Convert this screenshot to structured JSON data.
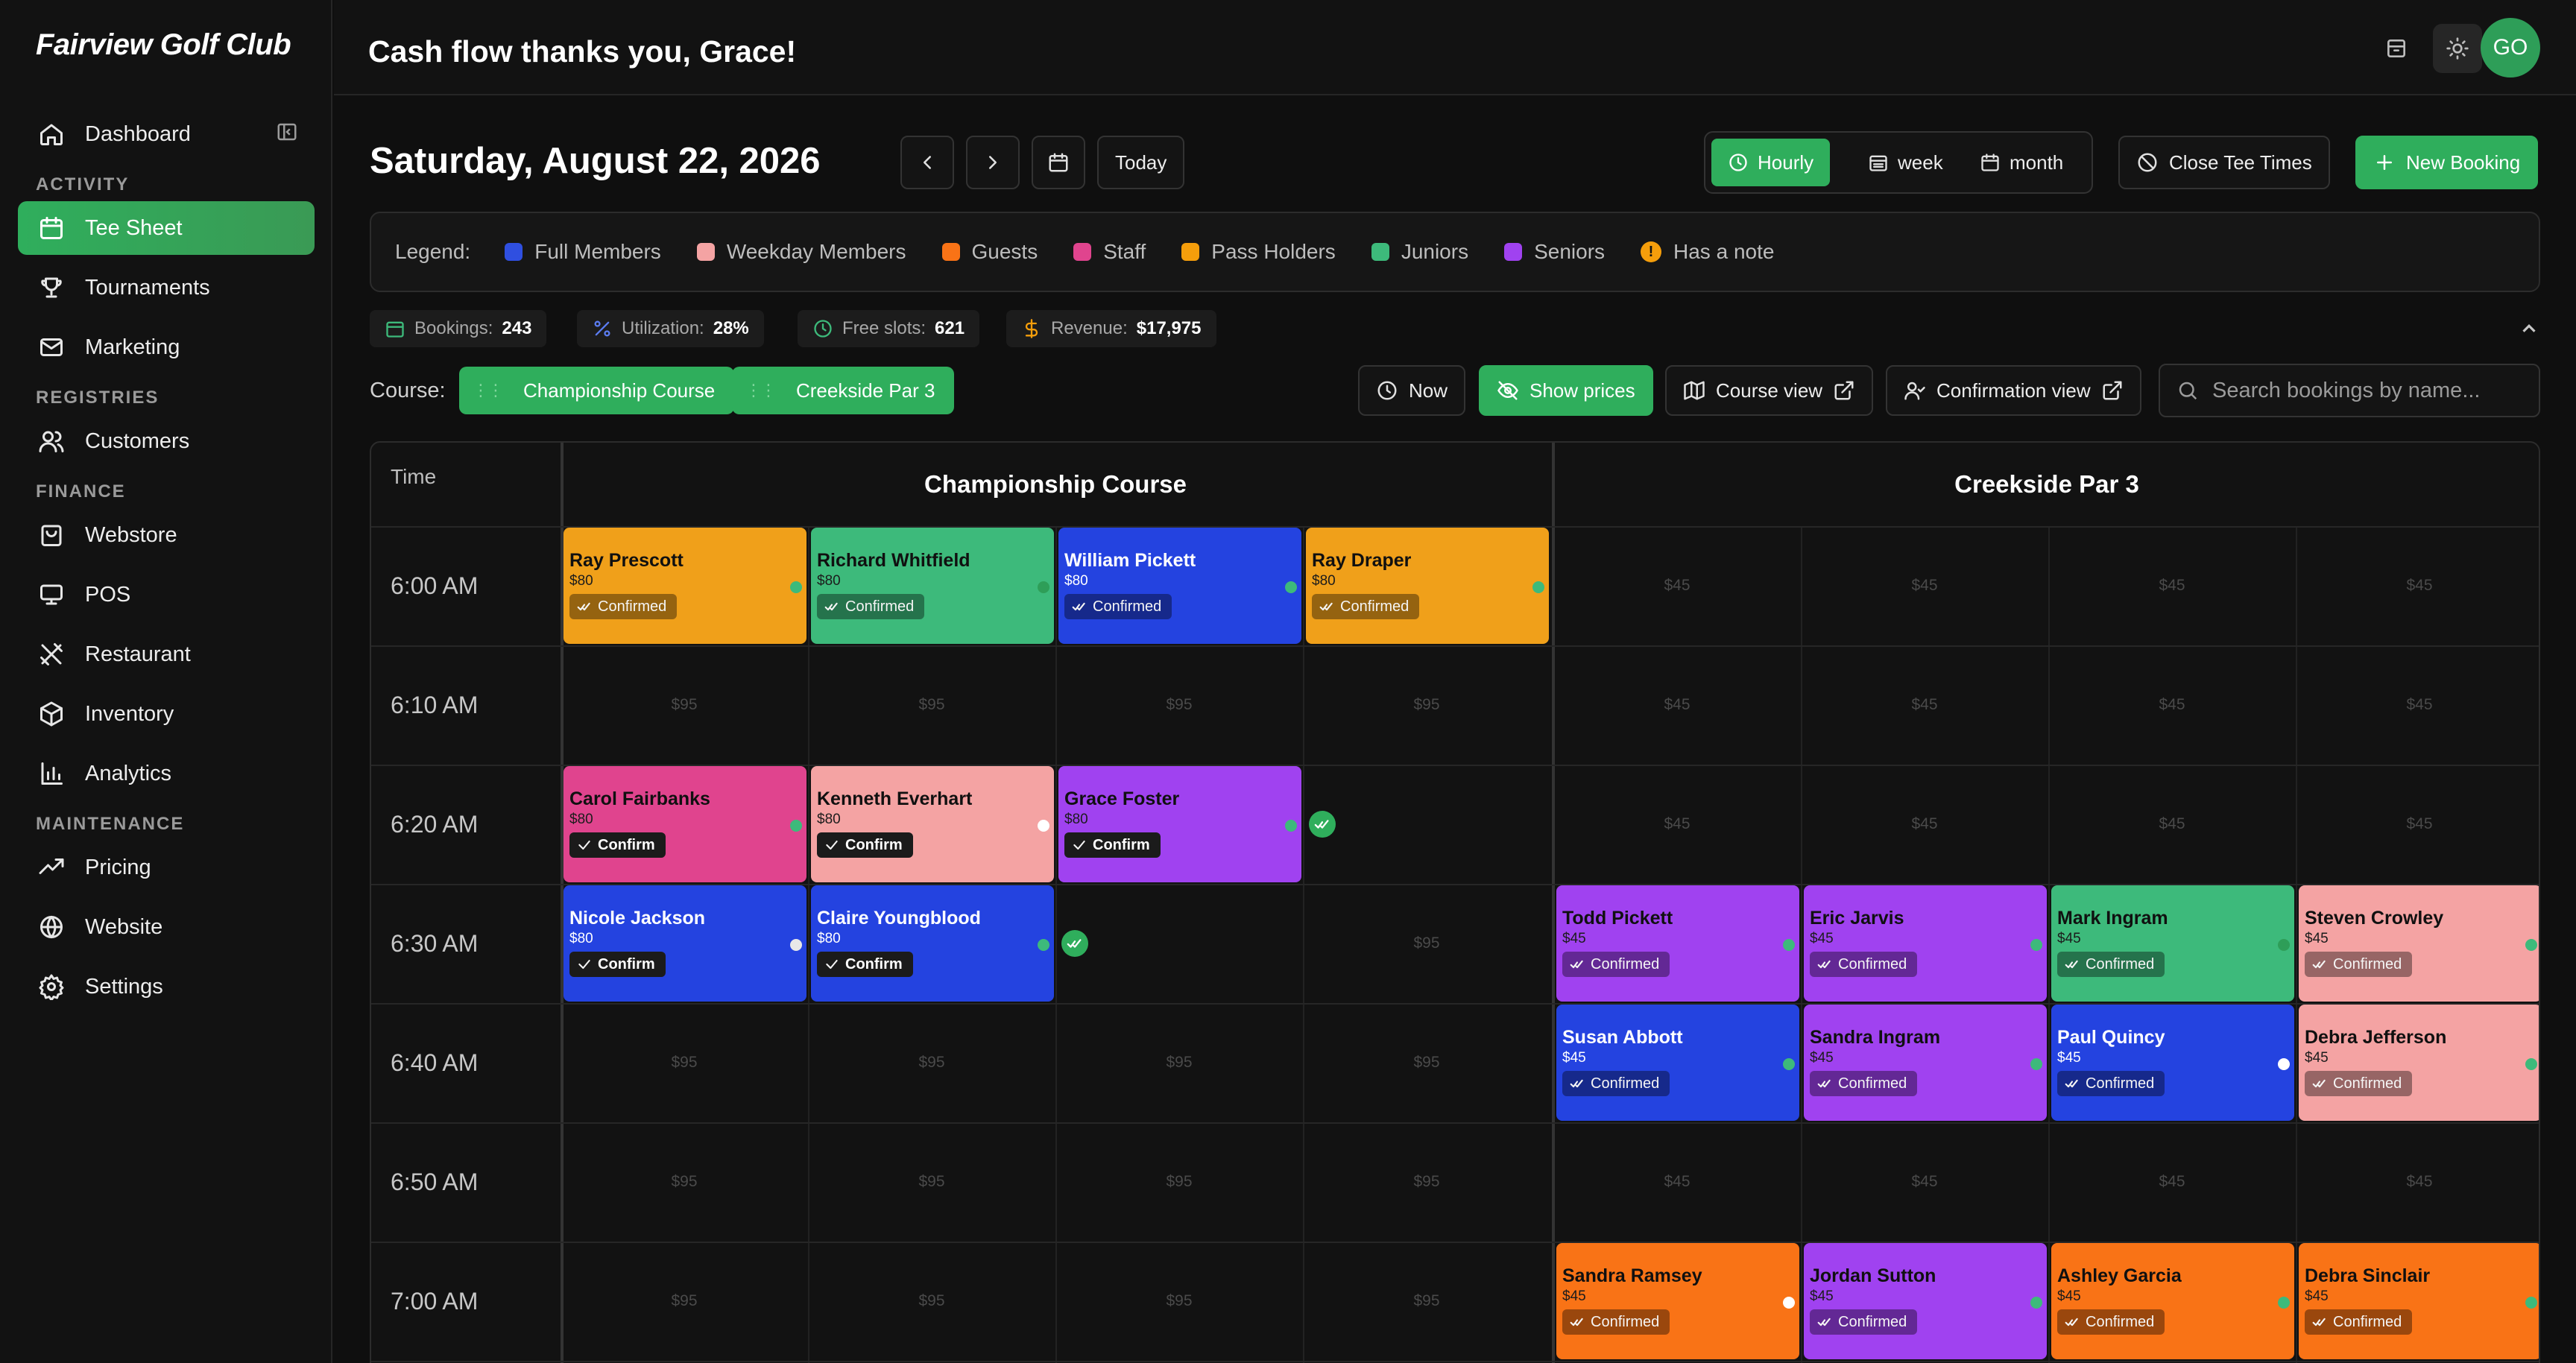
{
  "app": {
    "logo": "Fairview Golf Club",
    "greeting": "Cash flow thanks you, Grace!",
    "avatar_initials": "GO"
  },
  "sidebar": {
    "dashboard": "Dashboard",
    "sections": {
      "activity": "ACTIVITY",
      "registries": "REGISTRIES",
      "finance": "FINANCE",
      "maintenance": "MAINTENANCE"
    },
    "items": {
      "tee_sheet": "Tee Sheet",
      "tournaments": "Tournaments",
      "marketing": "Marketing",
      "customers": "Customers",
      "webstore": "Webstore",
      "pos": "POS",
      "restaurant": "Restaurant",
      "inventory": "Inventory",
      "analytics": "Analytics",
      "pricing": "Pricing",
      "website": "Website",
      "settings": "Settings"
    }
  },
  "toolbar": {
    "date": "Saturday, August 22, 2026",
    "today": "Today",
    "view_hourly": "Hourly",
    "view_week": "week",
    "view_month": "month",
    "close_tee_times": "Close Tee Times",
    "new_booking": "New Booking"
  },
  "legend": {
    "title": "Legend:",
    "items": [
      {
        "label": "Full Members",
        "color": "#2f4fe0"
      },
      {
        "label": "Weekday Members",
        "color": "#f4a3a3"
      },
      {
        "label": "Guests",
        "color": "#f97316"
      },
      {
        "label": "Staff",
        "color": "#e0448e"
      },
      {
        "label": "Pass Holders",
        "color": "#f59e0b"
      },
      {
        "label": "Juniors",
        "color": "#3dba7b"
      },
      {
        "label": "Seniors",
        "color": "#a042f0"
      }
    ],
    "note_label": "Has a note",
    "note_symbol": "!"
  },
  "stats": {
    "bookings_label": "Bookings:",
    "bookings": "243",
    "utilization_label": "Utilization:",
    "utilization": "28%",
    "free_label": "Free slots:",
    "free": "621",
    "revenue_label": "Revenue:",
    "revenue": "$17,975"
  },
  "filters": {
    "course_label": "Course:",
    "course_1": "Championship Course",
    "course_2": "Creekside Par 3",
    "now": "Now",
    "show_prices": "Show prices",
    "course_view": "Course view",
    "confirmation_view": "Confirmation view",
    "search_placeholder": "Search bookings by name..."
  },
  "grid": {
    "time_header": "Time",
    "course_1": "Championship Course",
    "course_2": "Creekside Par 3",
    "times": [
      "6:00 AM",
      "6:10 AM",
      "6:20 AM",
      "6:30 AM",
      "6:40 AM",
      "6:50 AM",
      "7:00 AM"
    ],
    "price_c1": "$95",
    "price_c2": "$45",
    "status_confirmed": "Confirmed",
    "status_confirm": "Confirm",
    "bookings": [
      {
        "row": 0,
        "col": 0,
        "name": "Ray Prescott",
        "price": "$80",
        "color": "#f0a01a",
        "light": false,
        "status": "confirmed",
        "dot": "#3dba7b"
      },
      {
        "row": 0,
        "col": 1,
        "name": "Richard Whitfield",
        "price": "$80",
        "color": "#3dba7b",
        "light": false,
        "status": "confirmed",
        "dot": "#2e9e58"
      },
      {
        "row": 0,
        "col": 2,
        "name": "William Pickett",
        "price": "$80",
        "color": "#2443e0",
        "light": true,
        "status": "confirmed",
        "dot": "#3dba7b"
      },
      {
        "row": 0,
        "col": 3,
        "name": "Ray Draper",
        "price": "$80",
        "color": "#f0a01a",
        "light": false,
        "status": "confirmed",
        "dot": "#3dba7b"
      },
      {
        "row": 2,
        "col": 0,
        "name": "Carol Fairbanks",
        "price": "$80",
        "color": "#e0448e",
        "light": false,
        "status": "confirm",
        "dot": "#3dba7b"
      },
      {
        "row": 2,
        "col": 1,
        "name": "Kenneth Everhart",
        "price": "$80",
        "color": "#f4a3a3",
        "light": false,
        "status": "confirm",
        "dot": "#ffffff"
      },
      {
        "row": 2,
        "col": 2,
        "name": "Grace Foster",
        "price": "$80",
        "color": "#a042f0",
        "light": false,
        "status": "confirm",
        "dot": "#3dba7b"
      },
      {
        "row": 3,
        "col": 0,
        "name": "Nicole Jackson",
        "price": "$80",
        "color": "#2443e0",
        "light": true,
        "status": "confirm",
        "dot": "#e8e8e8"
      },
      {
        "row": 3,
        "col": 1,
        "name": "Claire Youngblood",
        "price": "$80",
        "color": "#2443e0",
        "light": true,
        "status": "confirm",
        "dot": "#3dba7b"
      },
      {
        "row": 3,
        "col": 4,
        "name": "Todd Pickett",
        "price": "$45",
        "color": "#a042f0",
        "light": false,
        "status": "confirmed",
        "dot": "#3dba7b"
      },
      {
        "row": 3,
        "col": 5,
        "name": "Eric Jarvis",
        "price": "$45",
        "color": "#a042f0",
        "light": false,
        "status": "confirmed",
        "dot": "#3dba7b"
      },
      {
        "row": 3,
        "col": 6,
        "name": "Mark Ingram",
        "price": "$45",
        "color": "#3dba7b",
        "light": false,
        "status": "confirmed",
        "dot": "#2e9e58"
      },
      {
        "row": 3,
        "col": 7,
        "name": "Steven Crowley",
        "price": "$45",
        "color": "#f4a3a3",
        "light": false,
        "status": "confirmed",
        "dot": "#3dba7b"
      },
      {
        "row": 4,
        "col": 4,
        "name": "Susan Abbott",
        "price": "$45",
        "color": "#2443e0",
        "light": true,
        "status": "confirmed",
        "dot": "#3dba7b"
      },
      {
        "row": 4,
        "col": 5,
        "name": "Sandra Ingram",
        "price": "$45",
        "color": "#a042f0",
        "light": false,
        "status": "confirmed",
        "dot": "#3dba7b"
      },
      {
        "row": 4,
        "col": 6,
        "name": "Paul Quincy",
        "price": "$45",
        "color": "#2443e0",
        "light": true,
        "status": "confirmed",
        "dot": "#ffffff"
      },
      {
        "row": 4,
        "col": 7,
        "name": "Debra Jefferson",
        "price": "$45",
        "color": "#f4a3a3",
        "light": false,
        "status": "confirmed",
        "dot": "#3dba7b"
      },
      {
        "row": 6,
        "col": 4,
        "name": "Sandra Ramsey",
        "price": "$45",
        "color": "#f97316",
        "light": false,
        "status": "confirmed",
        "dot": "#ffffff"
      },
      {
        "row": 6,
        "col": 5,
        "name": "Jordan Sutton",
        "price": "$45",
        "color": "#a042f0",
        "light": false,
        "status": "confirmed",
        "dot": "#3dba7b"
      },
      {
        "row": 6,
        "col": 6,
        "name": "Ashley Garcia",
        "price": "$45",
        "color": "#f97316",
        "light": false,
        "status": "confirmed",
        "dot": "#3dba7b"
      },
      {
        "row": 6,
        "col": 7,
        "name": "Debra Sinclair",
        "price": "$45",
        "color": "#f97316",
        "light": false,
        "status": "confirmed",
        "dot": "#3dba7b"
      }
    ],
    "checks": [
      {
        "row": 2,
        "col": 3
      },
      {
        "row": 3,
        "col": 2
      }
    ]
  },
  "colors": {
    "accent": "#2fae5c",
    "background": "#0f0f0f",
    "panel": "#161616"
  }
}
